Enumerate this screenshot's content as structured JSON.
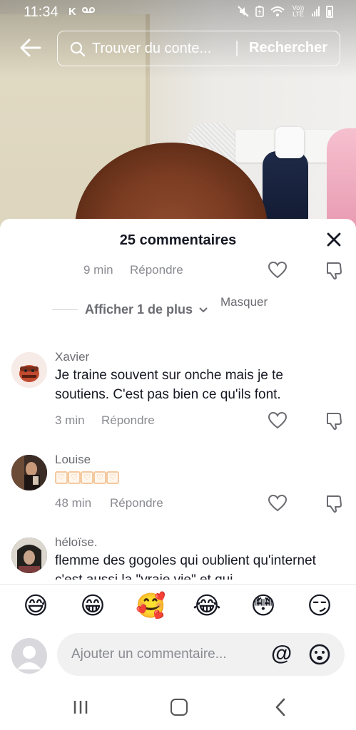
{
  "status_bar": {
    "time": "11:34",
    "left_icons": [
      "k-icon",
      "voicemail-icon"
    ],
    "right_icons": [
      "mute-icon",
      "battery-saver-icon",
      "wifi-icon",
      "volte-icon",
      "signal-icon",
      "battery-icon"
    ],
    "volte_label": "Vo)) LTE"
  },
  "search": {
    "placeholder": "Trouver du conte...",
    "button_label": "Rechercher"
  },
  "comments": {
    "title": "25 commentaires",
    "expand_label": "Afficher 1 de plus",
    "hide_label": "Masquer",
    "reply_label": "Répondre",
    "previous_reply": {
      "time": "9 min"
    },
    "items": [
      {
        "username": "Xavier",
        "text": "Je traine souvent sur onche mais je te soutiens. C'est pas bien ce qu'ils font.",
        "time": "3 min"
      },
      {
        "username": "Louise",
        "text": "",
        "time": "48 min"
      },
      {
        "username": "héloïse.",
        "text": "flemme des gogoles qui oublient qu'internet c'est aussi la \"vraie vie\" et qui"
      }
    ]
  },
  "emoji_bar": [
    "😅",
    "😁",
    "🥰",
    "😂",
    "😳",
    "😏"
  ],
  "composer": {
    "placeholder": "Ajouter un commentaire...",
    "at_symbol": "@"
  },
  "colors": {
    "text_primary": "#161823",
    "text_secondary": "#8a8b91",
    "input_bg": "#f1f1f2"
  }
}
